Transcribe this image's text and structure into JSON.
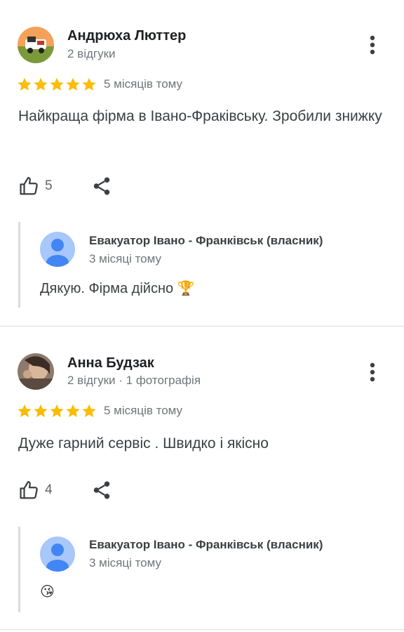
{
  "reviews": [
    {
      "author": "Андрюха Люттер",
      "meta": "2 відгуки",
      "rating": 5,
      "time": "5 місяців тому",
      "text": "Найкраща фірма в Івано-Фраківську. Зробили знижку",
      "likes": "5",
      "reply": {
        "owner": "Евакуатор Івано - Франківськ (власник)",
        "time": "3 місяці тому",
        "text": "Дякую. Фірма дійсно",
        "emoji": "🏆"
      }
    },
    {
      "author": "Анна Будзак",
      "meta": "2 відгуки · 1 фотографія",
      "rating": 5,
      "time": "5 місяців тому",
      "text": "Дуже гарний сервіс . Швидко і якісно",
      "likes": "4",
      "reply": {
        "owner": "Евакуатор Івано - Франківськ (власник)",
        "time": "3 місяці тому",
        "text": "",
        "emoji": "😘"
      }
    }
  ],
  "icons": {
    "star": "star-icon",
    "like": "thumbs-up-icon",
    "share": "share-icon",
    "more": "more-vert-icon",
    "owner_avatar": "person-icon"
  },
  "colors": {
    "star": "#fbbc04",
    "owner_avatar_bg": "#a8c7fa",
    "owner_avatar_fg": "#4285f4"
  }
}
